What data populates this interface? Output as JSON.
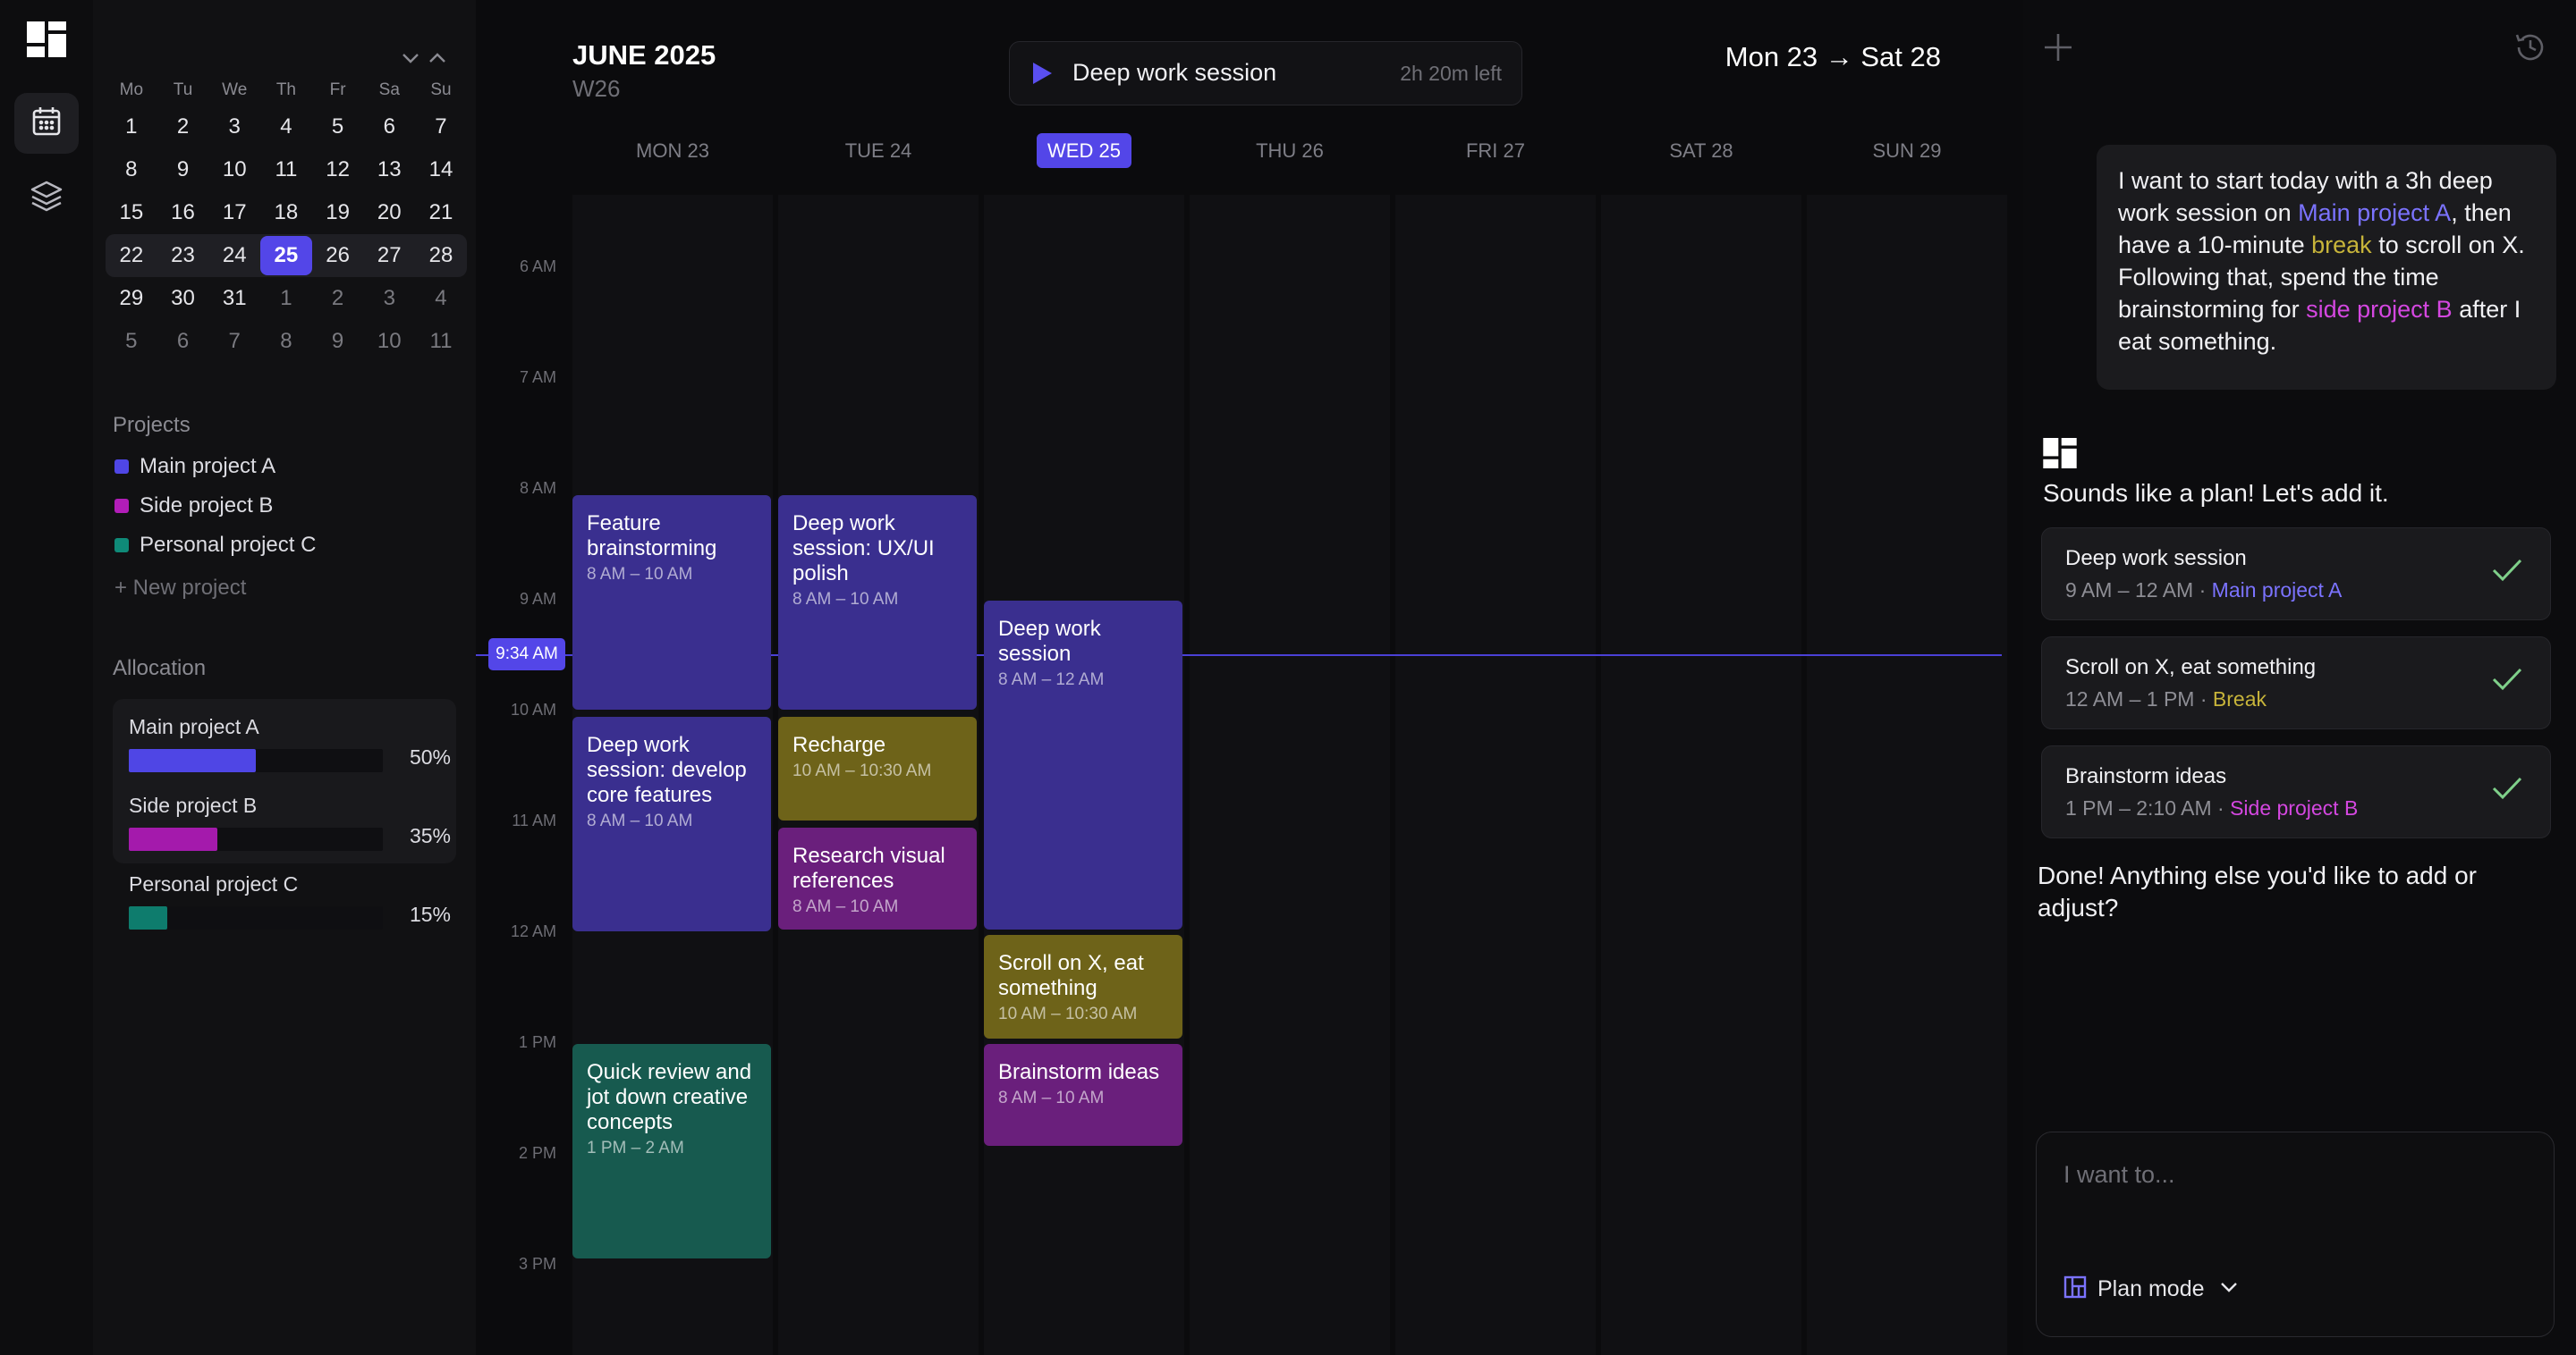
{
  "header": {
    "month": "JUNE 2025",
    "week": "W26",
    "range": "Mon 23 → Sat 28",
    "session": {
      "label": "Deep work session",
      "remaining": "2h 20m left"
    }
  },
  "mini_calendar": {
    "weekdays": [
      "Mo",
      "Tu",
      "We",
      "Th",
      "Fr",
      "Sa",
      "Su"
    ],
    "rows": [
      [
        "1",
        "2",
        "3",
        "4",
        "5",
        "6",
        "7"
      ],
      [
        "8",
        "9",
        "10",
        "11",
        "12",
        "13",
        "14"
      ],
      [
        "15",
        "16",
        "17",
        "18",
        "19",
        "20",
        "21"
      ],
      [
        "22",
        "23",
        "24",
        "25",
        "26",
        "27",
        "28"
      ],
      [
        "29",
        "30",
        "31",
        "1",
        "2",
        "3",
        "4"
      ],
      [
        "5",
        "6",
        "7",
        "8",
        "9",
        "10",
        "11"
      ]
    ],
    "today": "25"
  },
  "projects": {
    "title": "Projects",
    "items": [
      {
        "label": "Main project A",
        "color": "#4f46e5"
      },
      {
        "label": "Side project B",
        "color": "#b21db8"
      },
      {
        "label": "Personal project C",
        "color": "#0f8a78"
      }
    ],
    "new_label": "+ New project"
  },
  "allocation": {
    "title": "Allocation",
    "items": [
      {
        "name": "Main project A",
        "percent_text": "50%",
        "fraction": 0.5,
        "color": "#4f46e5"
      },
      {
        "name": "Side project B",
        "percent_text": "35%",
        "fraction": 0.35,
        "color": "#a41aac"
      },
      {
        "name": "Personal project C",
        "percent_text": "15%",
        "fraction": 0.15,
        "color": "#0e7c6d"
      }
    ]
  },
  "days": [
    "MON 23",
    "TUE 24",
    "WED 25",
    "THU 26",
    "FRI 27",
    "SAT 28",
    "SUN 29"
  ],
  "active_day": "WED 25",
  "hours": [
    "6 AM",
    "7 AM",
    "8 AM",
    "9 AM",
    "10 AM",
    "11 AM",
    "12 AM",
    "1 PM",
    "2 PM",
    "3 PM"
  ],
  "now_label": "9:34 AM",
  "events": [
    {
      "title": "Feature brainstorming",
      "time": "8 AM – 10 AM",
      "color": "#3a2f8f"
    },
    {
      "title": "Deep work session: develop core features",
      "time": "8 AM – 10 AM",
      "color": "#3a2f8f"
    },
    {
      "title": "Quick review and jot down creative concepts",
      "time": "1 PM – 2 AM",
      "color": "#175a4f"
    },
    {
      "title": "Deep work session: UX/UI polish",
      "time": "8 AM – 10 AM",
      "color": "#3a2f8f"
    },
    {
      "title": "Recharge",
      "time": "10 AM – 10:30 AM",
      "color": "#6e6319"
    },
    {
      "title": "Research visual references",
      "time": "8 AM – 10 AM",
      "color": "#6a1f7c"
    },
    {
      "title": "Deep work session",
      "time": "8 AM – 12 AM",
      "color": "#3a2f8f"
    },
    {
      "title": "Scroll on X, eat something",
      "time": "10 AM – 10:30 AM",
      "color": "#6e6319"
    },
    {
      "title": "Brainstorm ideas",
      "time": "8 AM – 10 AM",
      "color": "#6a1f7c"
    }
  ],
  "chat": {
    "user_message": {
      "p1": "I want to start today with a 3h deep work session on ",
      "h1": "Main project A",
      "p2": ", then have a 10-minute ",
      "h2": "break",
      "p3": " to scroll on X.  Following that, spend the time brainstorming for ",
      "h3": "side project B",
      "p4": " after I eat something."
    },
    "reply": "Sounds like a plan! Let's add it.",
    "tasks": [
      {
        "title": "Deep work session",
        "time": "9 AM – 12 AM",
        "project": "Main project A",
        "color": "#7b73ff"
      },
      {
        "title": "Scroll on X, eat something",
        "time": "12 AM – 1 PM",
        "project": "Break",
        "color": "#c7b43a"
      },
      {
        "title": "Brainstorm ideas",
        "time": "1 PM – 2:10 AM",
        "project": "Side project B",
        "color": "#d447e0"
      }
    ],
    "followup": "Done! Anything else you'd like to add or adjust?",
    "input_placeholder": "I want to...",
    "mode_label": "Plan mode"
  },
  "colors": {
    "accent": "#5346e8",
    "highlight_main": "#7b73ff",
    "highlight_break": "#c7b43a",
    "highlight_side": "#d447e0"
  }
}
